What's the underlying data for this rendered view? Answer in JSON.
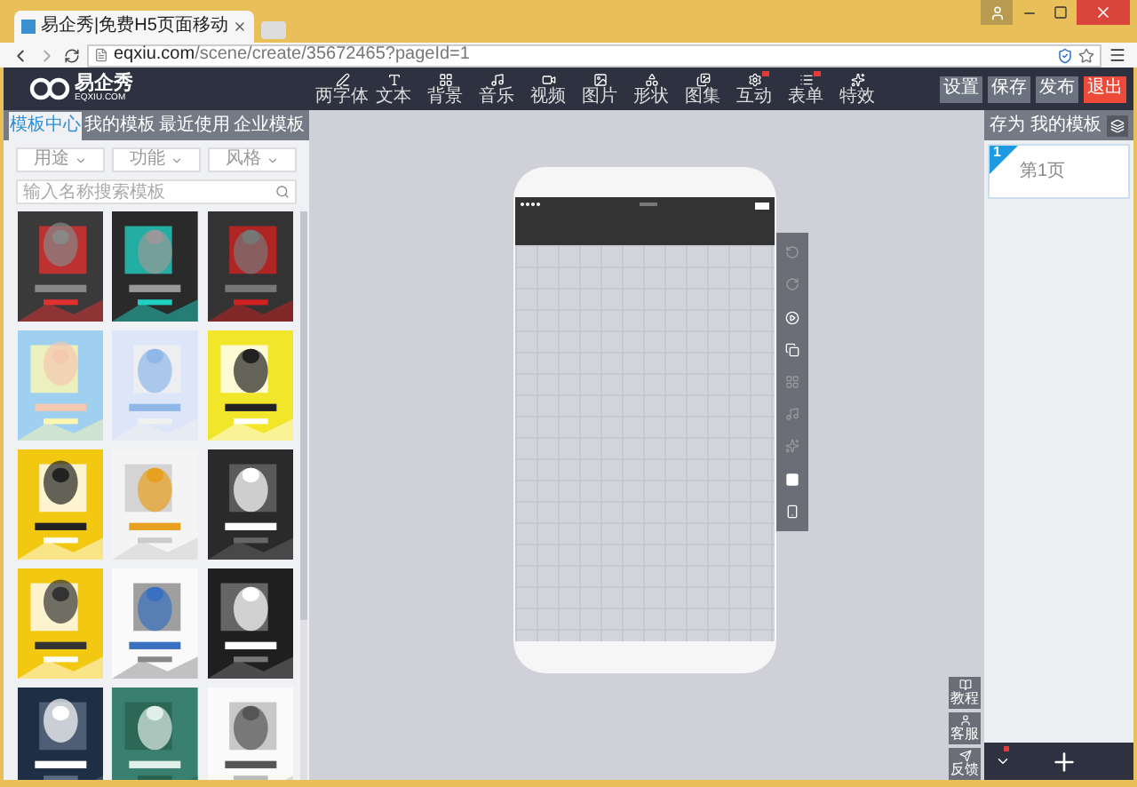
{
  "browser": {
    "tab_title": "易企秀|免费H5页面移动",
    "url_host": "eqxiu.com",
    "url_path": "/scene/create/35672465?pageId=1"
  },
  "header": {
    "logo": "易企秀",
    "logo_sub": "EQXIU.COM",
    "tools": [
      {
        "label": "两字体",
        "badge": false
      },
      {
        "label": "文本",
        "badge": false
      },
      {
        "label": "背景",
        "badge": false
      },
      {
        "label": "音乐",
        "badge": false
      },
      {
        "label": "视频",
        "badge": false
      },
      {
        "label": "图片",
        "badge": false
      },
      {
        "label": "形状",
        "badge": false
      },
      {
        "label": "图集",
        "badge": false
      },
      {
        "label": "互动",
        "badge": true
      },
      {
        "label": "表单",
        "badge": true
      },
      {
        "label": "特效",
        "badge": false
      }
    ],
    "actions": [
      {
        "label": "设置",
        "kind": "normal"
      },
      {
        "label": "保存",
        "kind": "normal"
      },
      {
        "label": "发布",
        "kind": "normal"
      },
      {
        "label": "退出",
        "kind": "danger"
      }
    ]
  },
  "left_panel": {
    "tabs": [
      {
        "label": "模板中心",
        "selected": true
      },
      {
        "label": "我的模板",
        "selected": false
      },
      {
        "label": "最近使用",
        "selected": false
      },
      {
        "label": "企业模板",
        "selected": false
      }
    ],
    "filters": [
      "用途",
      "功能",
      "风格"
    ],
    "search": {
      "placeholder": "输入名称搜索模板"
    }
  },
  "right_panel": {
    "title": "存为 我的模板",
    "pages": [
      {
        "number": "1",
        "label": "第1页",
        "selected": true
      }
    ]
  },
  "help_buttons": [
    {
      "label": "教程"
    },
    {
      "label": "客服"
    },
    {
      "label": "反馈"
    }
  ]
}
